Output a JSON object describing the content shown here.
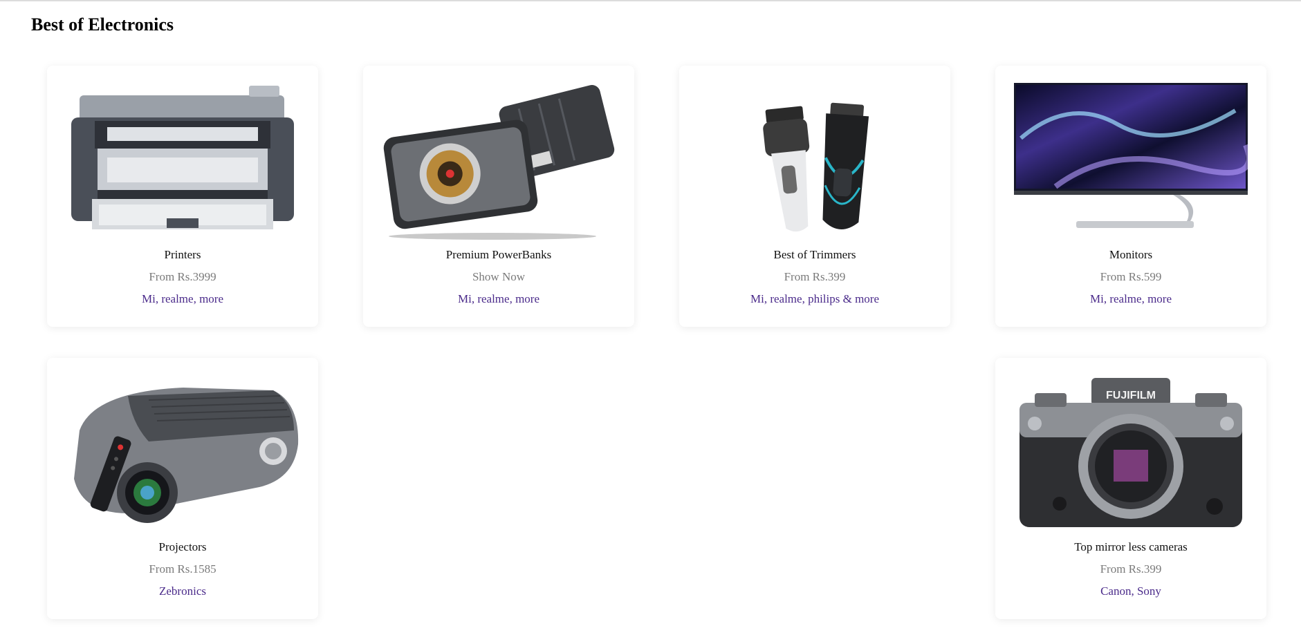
{
  "section": {
    "title": "Best of Electronics"
  },
  "products": [
    {
      "name": "Printers",
      "price": "From Rs.3999",
      "brands": "Mi, realme, more",
      "image_icon": "printer-image"
    },
    {
      "name": "Premium PowerBanks",
      "price": "Show Now",
      "brands": "Mi, realme, more",
      "image_icon": "powerbank-image"
    },
    {
      "name": "Best of Trimmers",
      "price": "From Rs.399",
      "brands": "Mi, realme, philips & more",
      "image_icon": "trimmer-image"
    },
    {
      "name": "Monitors",
      "price": "From Rs.599",
      "brands": "Mi, realme, more",
      "image_icon": "monitor-image"
    },
    {
      "name": "Projectors",
      "price": "From Rs.1585",
      "brands": "Zebronics",
      "image_icon": "projector-image"
    },
    {
      "name": "Top mirror less cameras",
      "price": "From Rs.399",
      "brands": "Canon, Sony",
      "image_icon": "camera-image"
    }
  ],
  "colors": {
    "brand_text": "#4a2a8a",
    "price_text": "#7a7a7a"
  },
  "camera_logo_text": "FUJIFILM"
}
